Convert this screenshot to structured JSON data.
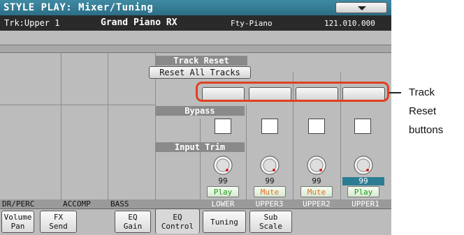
{
  "title": "STYLE PLAY: Mixer/Tuning",
  "menu_icon": "triangle-down-icon",
  "info": {
    "track": "Trk:Upper 1",
    "sound": "Grand Piano RX",
    "bank": "Fty-Piano",
    "number": "121.010.000"
  },
  "sections": {
    "track_reset": "Track Reset",
    "reset_all": "Reset All Tracks",
    "bypass": "Bypass",
    "input_trim": "Input Trim"
  },
  "channels": [
    {
      "label": "DR/PERC"
    },
    {
      "label": "ACCOMP"
    },
    {
      "label": "BASS"
    },
    {
      "label": "LOWER"
    },
    {
      "label": "UPPER3",
      "value": "99",
      "state": "Mute"
    },
    {
      "label": "UPPER2",
      "value": "99",
      "state": "Mute"
    },
    {
      "label": "UPPER1",
      "value": "99",
      "state": "Play",
      "selected": true
    }
  ],
  "lower": {
    "value": "99",
    "state": "Play"
  },
  "tabs": [
    {
      "label": "Volume\nPan"
    },
    {
      "label": "FX\nSend"
    },
    {
      "label": "EQ\nGain"
    },
    {
      "label": "EQ\nControl",
      "active": true
    },
    {
      "label": "Tuning"
    },
    {
      "label": "Sub\nScale"
    }
  ],
  "annotation": {
    "line1": "Track",
    "line2": "Reset",
    "line3": "buttons",
    "color": "#e0401e"
  }
}
